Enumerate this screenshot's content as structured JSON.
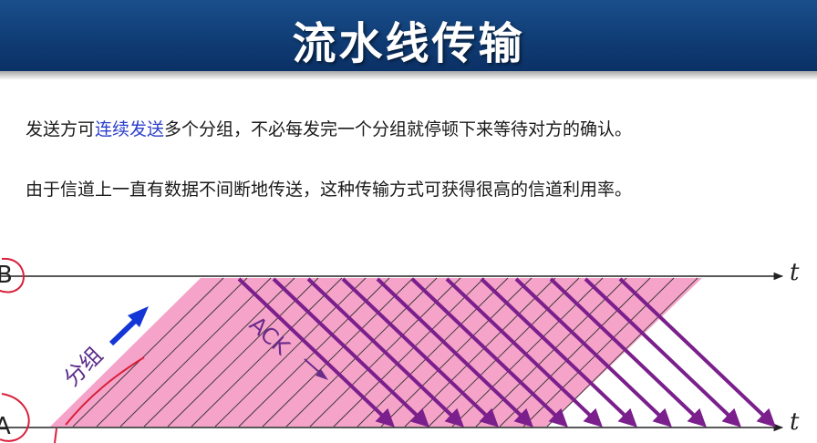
{
  "header": {
    "title": "流水线传输"
  },
  "text": {
    "line1_before": "发送方可",
    "line1_highlight": "连续发送",
    "line1_after": "多个分组，不必每发完一个分组就停顿下来等待对方的确认。",
    "line2": "由于信道上一直有数据不间断地传送，这种传输方式可获得很高的信道利用率。"
  },
  "diagram": {
    "station_top": "B",
    "station_bottom": "A",
    "time_label_top": "t",
    "time_label_bottom": "t",
    "packet_label": "分组",
    "ack_label": "ACK",
    "colors": {
      "packet_fill": "#f5a3c9",
      "packet_line": "#333333",
      "ack": "#7a1f8c",
      "arrow_blue": "#1436d6",
      "annotation_red": "#d8203a"
    }
  }
}
